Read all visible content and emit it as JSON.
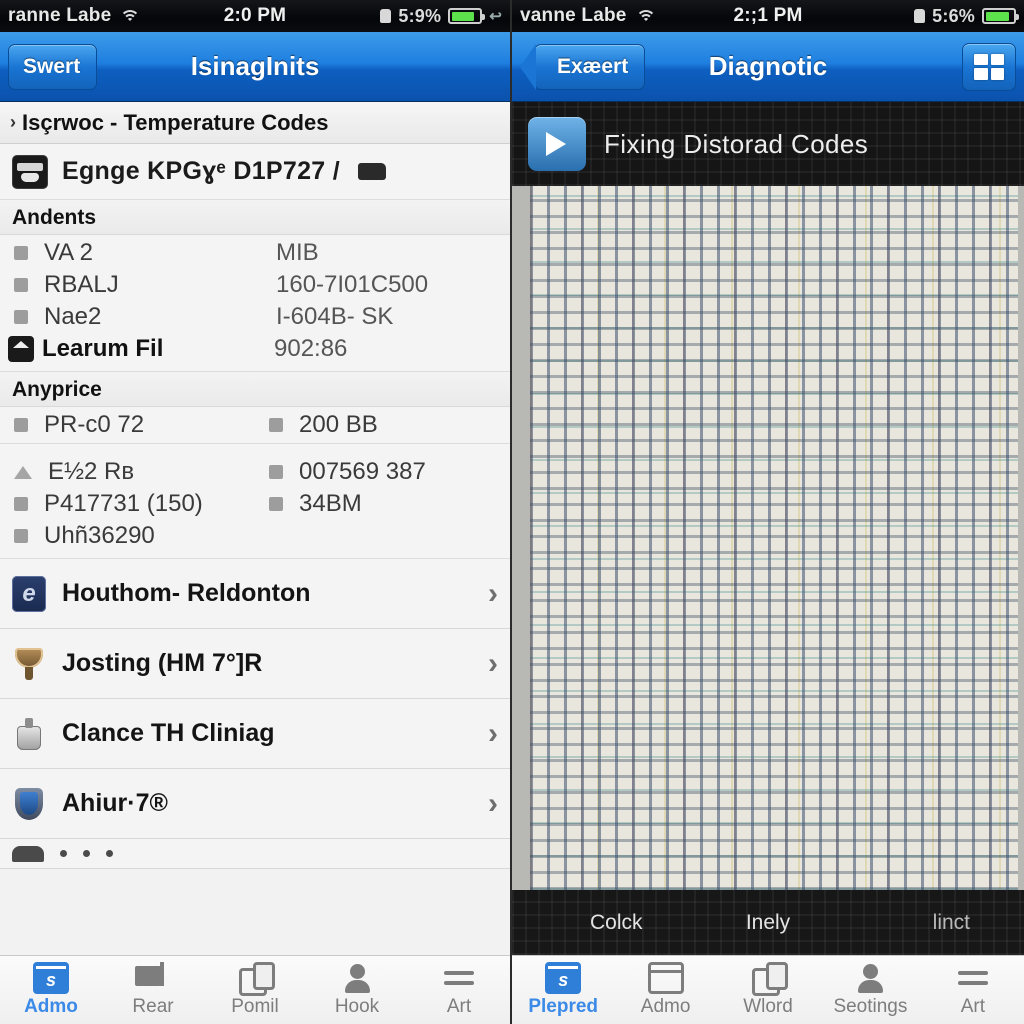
{
  "left": {
    "status": {
      "carrier": "ranne Labe",
      "wifi_icon": "wifi-icon",
      "time": "2:0 PM",
      "lock_icon": "lock-icon",
      "battery_pct": "5:9%",
      "battery_fill": 82,
      "tail": "↩"
    },
    "nav": {
      "back_label": "Swert",
      "title": "IsinagInits",
      "title_raw": "I3inagInits"
    },
    "breadcrumb": {
      "chevron": "›",
      "text": "Isçrwoc - Temperature Codes"
    },
    "code_row": {
      "icon": "engine-icon",
      "text": "Egnge KPGɣᵉ D1P727 /"
    },
    "section_one": {
      "header": "Andents",
      "rows": [
        {
          "bullet": "square",
          "key": "VA 2",
          "value": "MIB"
        },
        {
          "bullet": "square",
          "key": "RBALJ",
          "value": "160-7I01C500"
        },
        {
          "bullet": "square",
          "key": "Nae2",
          "value": "I-604B- SK"
        },
        {
          "bullet": "gem",
          "key": "Learum Fil",
          "value": "902:86",
          "bold": true
        }
      ]
    },
    "section_two": {
      "header": "Anyprice",
      "left_rows": [
        {
          "bullet": "square",
          "key": "PR-c0 72"
        }
      ],
      "right_rows": [
        {
          "bullet": "square",
          "key": "200 BB"
        }
      ],
      "left_rows_b": [
        {
          "bullet": "triangle",
          "key": "E½2 Rʙ"
        },
        {
          "bullet": "square",
          "key": "P417731 (150)"
        },
        {
          "bullet": "square",
          "key": "Uhñ36290"
        }
      ],
      "right_rows_b": [
        {
          "bullet": "square",
          "key": "007569 387"
        },
        {
          "bullet": "square",
          "key": "34BM"
        }
      ]
    },
    "nav_rows": [
      {
        "icon": "badge-e-icon",
        "label": "Houthom- Reldonton",
        "chevron": "›"
      },
      {
        "icon": "trophy-icon",
        "label": "Josting (HM 7°]R",
        "chevron": "›"
      },
      {
        "icon": "bag-icon",
        "label": "Clance TH Cliniag",
        "chevron": "›"
      },
      {
        "icon": "shield-icon",
        "label": "Ahiur·7®",
        "chevron": "›"
      }
    ],
    "tabs": [
      {
        "icon": "window-blue-icon",
        "label": "Admo",
        "active": true
      },
      {
        "icon": "flag-icon",
        "label": "Rear",
        "active": false
      },
      {
        "icon": "copy-icon",
        "label": "Pomil",
        "active": false
      },
      {
        "icon": "person-icon",
        "label": "Hook",
        "active": false
      },
      {
        "icon": "more-icon",
        "label": "Art",
        "active": false
      }
    ]
  },
  "right": {
    "status": {
      "carrier": "vanne Labe",
      "wifi_icon": "wifi-icon",
      "time": "2:;1 PM",
      "lock_icon": "lock-icon",
      "battery_pct": "5:6%",
      "battery_fill": 88
    },
    "nav": {
      "back_label": "Exæert",
      "title": "Diagnotic",
      "grid_icon": "grid-icon"
    },
    "video": {
      "play_icon": "play-icon",
      "title": "Fixing Distorad Codes"
    },
    "captions": [
      "Colck",
      "Inely",
      "linct"
    ],
    "tabs": [
      {
        "icon": "briefcase-blue-icon",
        "label": "Plepred",
        "active": true
      },
      {
        "icon": "window-icon",
        "label": "Admo",
        "active": false
      },
      {
        "icon": "copy-icon",
        "label": "Wlord",
        "active": false
      },
      {
        "icon": "person-icon",
        "label": "Seotings",
        "active": false
      },
      {
        "icon": "more-icon",
        "label": "Art",
        "active": false
      }
    ]
  },
  "colors": {
    "nav_blue": "#1f7fe0",
    "accent_blue": "#3b8ae8",
    "battery_green": "#5de24e",
    "panel_bg": "#f4f4f4",
    "dark_media": "#151515"
  }
}
